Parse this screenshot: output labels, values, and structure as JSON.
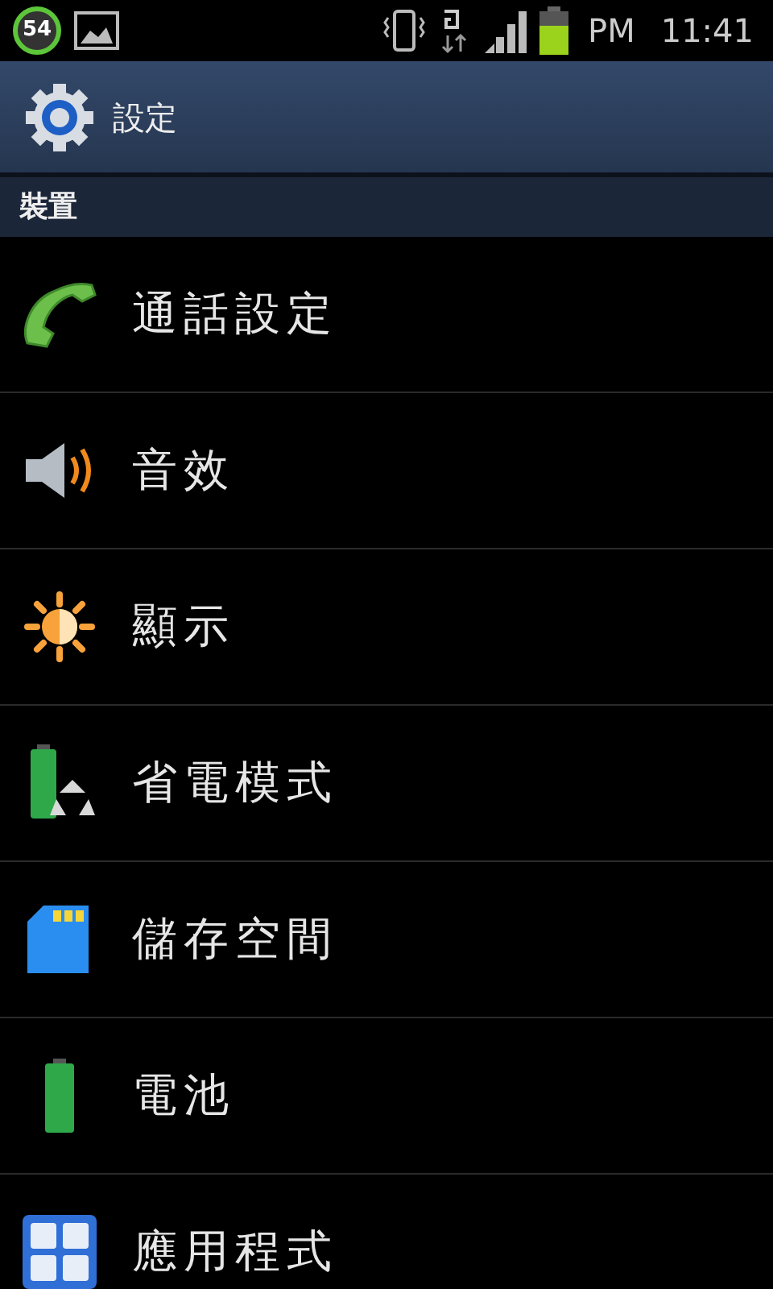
{
  "status_bar": {
    "notification_count": "54",
    "ampm": "PM",
    "time": "11:41"
  },
  "header": {
    "title": "設定"
  },
  "section": {
    "title": "裝置"
  },
  "items": [
    {
      "label": "通話設定",
      "kind": "phone"
    },
    {
      "label": "音效",
      "kind": "sound"
    },
    {
      "label": "顯示",
      "kind": "display"
    },
    {
      "label": "省電模式",
      "kind": "power-saving"
    },
    {
      "label": "儲存空間",
      "kind": "storage"
    },
    {
      "label": "電池",
      "kind": "battery"
    },
    {
      "label": "應用程式",
      "kind": "apps"
    }
  ]
}
